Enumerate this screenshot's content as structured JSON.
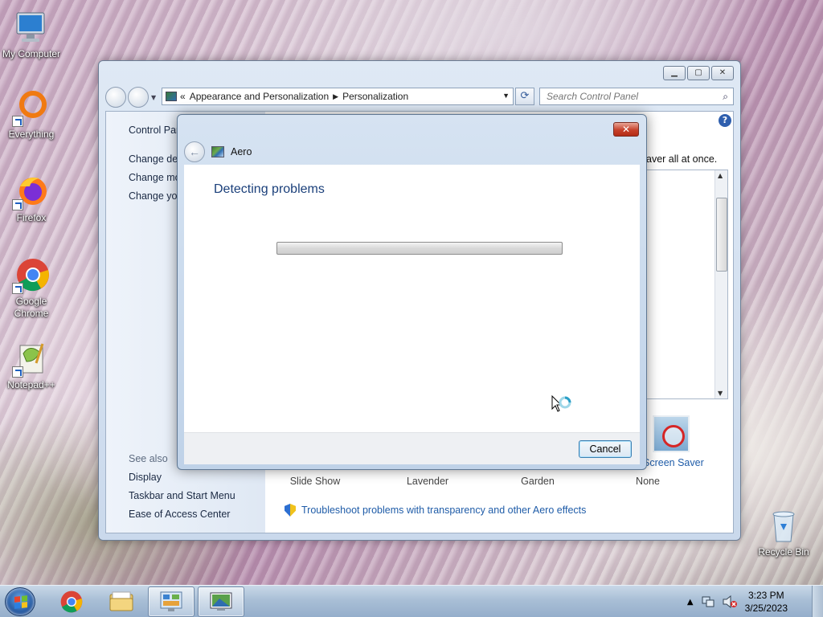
{
  "desktop": {
    "icons": [
      {
        "label": "My Computer"
      },
      {
        "label": "Everything"
      },
      {
        "label": "Firefox"
      },
      {
        "label": "Google Chrome"
      },
      {
        "label": "Notepad++"
      },
      {
        "label": "Recycle Bin"
      }
    ]
  },
  "control_panel": {
    "address": {
      "prefix": "«",
      "crumb1": "Appearance and Personalization",
      "crumb2": "Personalization"
    },
    "search_placeholder": "Search Control Panel",
    "left": {
      "home_link": "Control Panel Home",
      "link1": "Change desktop icons",
      "link2": "Change mouse pointers",
      "link3": "Change your account picture",
      "see_also": "See also",
      "display": "Display",
      "taskbar": "Taskbar and Start Menu",
      "ease": "Ease of Access Center"
    },
    "partial_text": "aver all at once.",
    "screen_saver": {
      "label": "Screen Saver",
      "value": "None"
    },
    "theme_captions": {
      "slide_show": "Slide Show",
      "lavender": "Lavender",
      "garden": "Garden"
    },
    "troubleshoot_link": "Troubleshoot problems with transparency and other Aero effects"
  },
  "dialog": {
    "title": "Aero",
    "heading": "Detecting problems",
    "progress": 0,
    "cancel_label": "Cancel"
  },
  "taskbar": {
    "time": "3:23 PM",
    "date": "3/25/2023"
  }
}
